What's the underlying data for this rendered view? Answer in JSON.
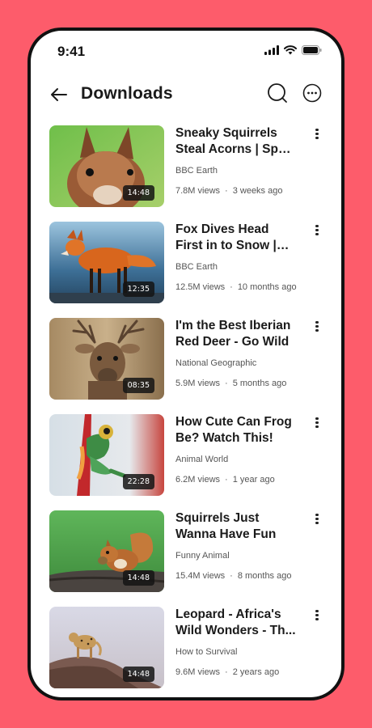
{
  "status_bar": {
    "time": "9:41"
  },
  "header": {
    "title": "Downloads"
  },
  "videos": [
    {
      "title": "Sneaky Squirrels Steal Acorns | Spy ...",
      "channel": "BBC Earth",
      "views": "7.8M views",
      "age": "3 weeks ago",
      "duration": "14:48"
    },
    {
      "title": "Fox Dives Head First in to Snow | Planet ..",
      "channel": "BBC Earth",
      "views": "12.5M views",
      "age": "10 months ago",
      "duration": "12:35"
    },
    {
      "title": "I'm the Best Iberian Red Deer - Go Wild",
      "channel": "National Geographic",
      "views": "5.9M views",
      "age": "5 months ago",
      "duration": "08:35"
    },
    {
      "title": "How Cute Can Frog Be? Watch This!",
      "channel": "Animal World",
      "views": "6.2M views",
      "age": "1 year ago",
      "duration": "22:28"
    },
    {
      "title": "Squirrels Just Wanna Have Fun",
      "channel": "Funny Animal",
      "views": "15.4M views",
      "age": "8 months ago",
      "duration": "14:48"
    },
    {
      "title": "Leopard - Africa's Wild Wonders - Th...",
      "channel": "How to Survival",
      "views": "9.6M views",
      "age": "2 years ago",
      "duration": "14:48"
    }
  ],
  "meta_separator": "·",
  "icons": {
    "back": "arrow-left-icon",
    "search": "search-icon",
    "more": "more-horizontal-circle-icon",
    "item_more": "more-vertical-icon"
  },
  "colors": {
    "background": "#FD5C6B",
    "phone_frame": "#111111",
    "screen": "#FFFFFF"
  }
}
